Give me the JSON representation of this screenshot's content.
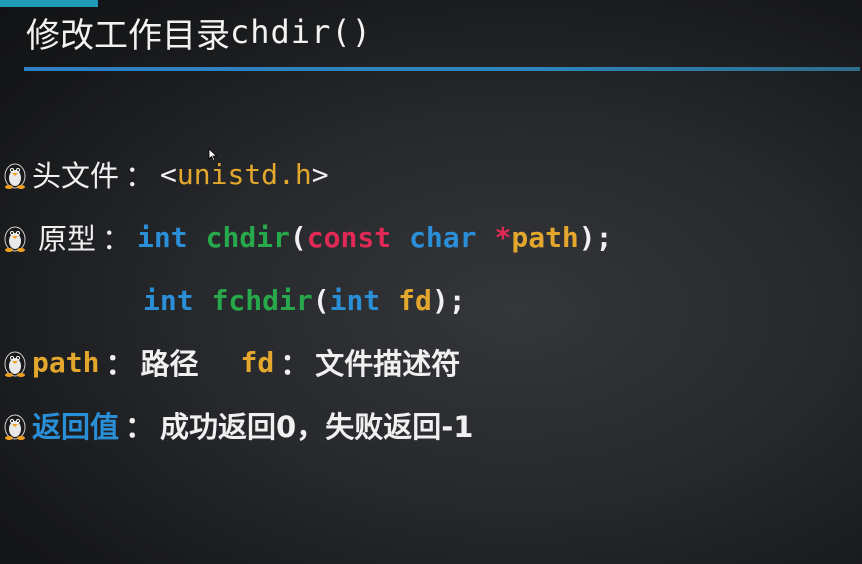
{
  "slide": {
    "title_cn": "修改工作目录",
    "title_code": "chdir()",
    "colors": {
      "background": "#1c1d1f",
      "text": "#f0f0f0",
      "keyword_blue": "#2a8fd6",
      "function_green": "#27a84a",
      "keyword_red": "#e02a55",
      "identifier_orange": "#e2a72c",
      "rule_blue": "#2f7fc4"
    },
    "bullet_icon": "penguin-icon",
    "header": {
      "label": "头文件",
      "colon": "：",
      "lt": "<",
      "file": "unistd.h",
      "gt": ">"
    },
    "prototype": {
      "label": "原型",
      "colon": "：",
      "line1": {
        "type": "int",
        "name": "chdir",
        "open": "(",
        "qualifier": "const",
        "ptype": "char",
        "star": "*",
        "param": "path",
        "close": ");"
      },
      "line2": {
        "type": "int",
        "name": "fchdir",
        "open": "(",
        "ptype": "int",
        "param": "fd",
        "close": ");"
      }
    },
    "params": {
      "p1_name": "path",
      "colon1": "：",
      "p1_desc": "路径",
      "p2_name": "fd",
      "colon2": "：",
      "p2_desc": "文件描述符"
    },
    "return_value": {
      "label": "返回值",
      "colon": "：",
      "success": "成功返回0",
      "comma": "，",
      "failure": "失败返回-1"
    }
  }
}
